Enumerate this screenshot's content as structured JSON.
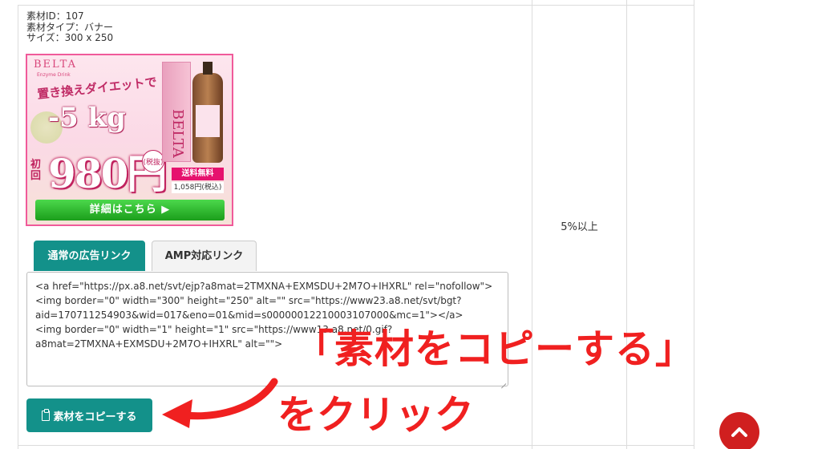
{
  "material": {
    "id_line": "素材ID：107",
    "type_line": "素材タイプ：バナー",
    "size_line": "サイズ：300 x 250"
  },
  "banner": {
    "logo": "BELTA",
    "subtitle": "Enzyme Drink",
    "catch": "置き換えダイエットで",
    "kg": "-5 kg",
    "price": "980円",
    "tax_badge": "(税抜)",
    "first_time": "初回",
    "shipping": "送料無料",
    "tax_included": "1,058円(税込)",
    "box_label": "BELTA",
    "cta": "詳細はこちら ▶"
  },
  "tabs": [
    {
      "label": "通常の広告リンク",
      "active": true
    },
    {
      "label": "AMP対応リンク",
      "active": false
    }
  ],
  "code": "<a href=\"https://px.a8.net/svt/ejp?a8mat=2TMXNA+EXMSDU+2M7O+IHXRL\" rel=\"nofollow\">\n<img border=\"0\" width=\"300\" height=\"250\" alt=\"\" src=\"https://www23.a8.net/svt/bgt?aid=170711254903&wid=017&eno=01&mid=s00000012210003107000&mc=1\"></a>\n<img border=\"0\" width=\"1\" height=\"1\" src=\"https://www13.a8.net/0.gif?a8mat=2TMXNA+EXMSDU+2M7O+IHXRL\" alt=\"\">",
  "copy_button": "素材をコピーする",
  "reward": "5%以上",
  "annotation": {
    "line1": "「素材をコピーする」",
    "line2": "をクリック"
  },
  "colors": {
    "accent": "#13918a",
    "annotation": "#f02020",
    "scroll_top": "#d01f1f"
  }
}
